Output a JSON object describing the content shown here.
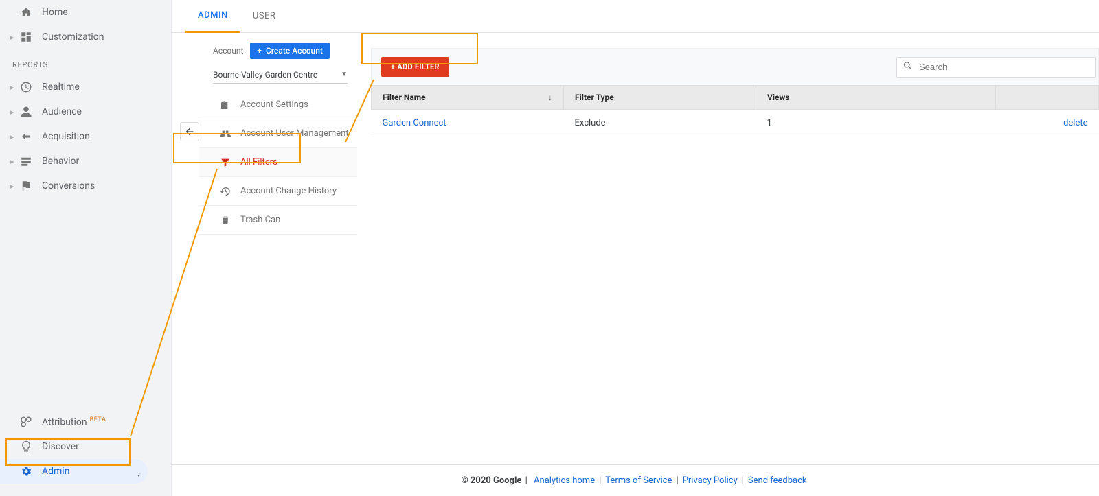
{
  "sidebar": {
    "home": "Home",
    "customization": "Customization",
    "reports_header": "REPORTS",
    "realtime": "Realtime",
    "audience": "Audience",
    "acquisition": "Acquisition",
    "behavior": "Behavior",
    "conversions": "Conversions",
    "attribution": "Attribution",
    "attribution_badge": "BETA",
    "discover": "Discover",
    "admin": "Admin"
  },
  "tabs": {
    "admin": "ADMIN",
    "user": "USER"
  },
  "account": {
    "label": "Account",
    "create_button": "Create Account",
    "selected": "Bourne Valley Garden Centre",
    "menu": {
      "settings": "Account Settings",
      "users": "Account User Management",
      "filters": "All Filters",
      "history": "Account Change History",
      "trash": "Trash Can"
    }
  },
  "content": {
    "add_filter_button": "+ ADD FILTER",
    "search_placeholder": "Search",
    "headers": {
      "name": "Filter Name",
      "type": "Filter Type",
      "views": "Views"
    },
    "rows": [
      {
        "name": "Garden Connect",
        "type": "Exclude",
        "views": "1",
        "delete": "delete"
      }
    ]
  },
  "footer": {
    "copyright": "© 2020 Google",
    "links": {
      "analytics_home": "Analytics home",
      "terms": "Terms of Service",
      "privacy": "Privacy Policy",
      "feedback": "Send feedback"
    }
  }
}
